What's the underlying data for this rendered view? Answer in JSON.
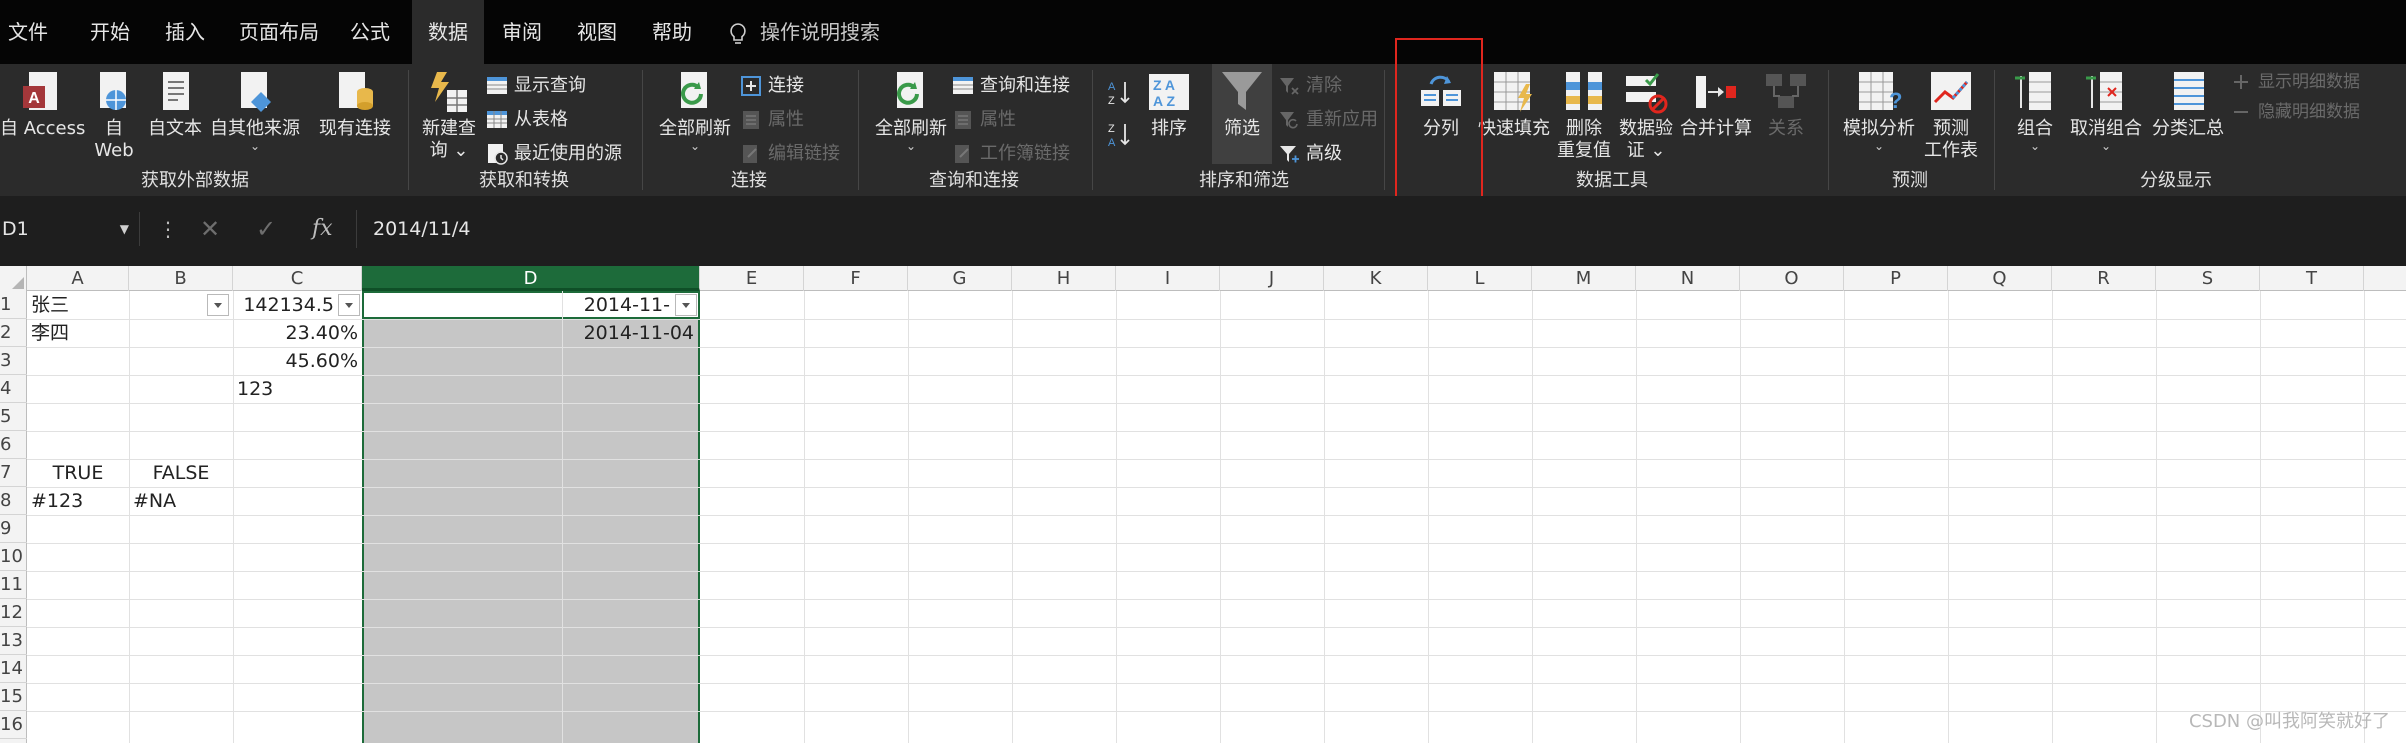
{
  "menu": {
    "tabs": [
      "文件",
      "开始",
      "插入",
      "页面布局",
      "公式",
      "数据",
      "审阅",
      "视图",
      "帮助"
    ],
    "active_tab": "数据",
    "tell_me": "操作说明搜索"
  },
  "ribbon": {
    "get_external_data": {
      "group_label": "获取外部数据",
      "access": "自 Access",
      "web_line1": "自",
      "web_line2": "Web",
      "text": "自文本",
      "other": "自其他来源",
      "existing": "现有连接"
    },
    "get_transform": {
      "group_label": "获取和转换",
      "new_query_line1": "新建查",
      "new_query_line2": "询",
      "show_queries": "显示查询",
      "from_table": "从表格",
      "recent_sources": "最近使用的源"
    },
    "connections": {
      "group_label": "连接",
      "refresh_all": "全部刷新",
      "connections": "连接",
      "properties": "属性",
      "edit_links": "编辑链接"
    },
    "queries_connections": {
      "group_label": "查询和连接",
      "refresh_all": "全部刷新",
      "queries_connections": "查询和连接",
      "properties": "属性",
      "workbook_links": "工作簿链接"
    },
    "sort_filter": {
      "group_label": "排序和筛选",
      "sort": "排序",
      "filter": "筛选",
      "clear": "清除",
      "reapply": "重新应用",
      "advanced": "高级"
    },
    "data_tools": {
      "group_label": "数据工具",
      "text_to_columns": "分列",
      "flash_fill": "快速填充",
      "remove_dup_line1": "删除",
      "remove_dup_line2": "重复值",
      "validation_line1": "数据验",
      "validation_line2": "证",
      "consolidate": "合并计算",
      "relationships": "关系"
    },
    "forecast": {
      "group_label": "预测",
      "what_if": "模拟分析",
      "forecast_line1": "预测",
      "forecast_line2": "工作表"
    },
    "outline": {
      "group_label": "分级显示",
      "group": "组合",
      "ungroup": "取消组合",
      "subtotal": "分类汇总",
      "show_detail": "显示明细数据",
      "hide_detail": "隐藏明细数据"
    }
  },
  "formula_bar": {
    "name_box": "D1",
    "formula": "2014/11/4",
    "fx": "fx"
  },
  "sheet": {
    "columns": [
      "A",
      "B",
      "C",
      "D",
      "E",
      "F",
      "G",
      "H",
      "I",
      "J",
      "K",
      "L",
      "M",
      "N",
      "O",
      "P",
      "Q",
      "R",
      "S",
      "T"
    ],
    "rows": [
      "1",
      "2",
      "3",
      "4",
      "5",
      "6",
      "7",
      "8",
      "9",
      "10",
      "11",
      "12",
      "13",
      "14",
      "15",
      "16"
    ],
    "selected_column": "D",
    "cells": {
      "A1": "张三",
      "A2": "李四",
      "C1": "142134.5",
      "C2": "23.40%",
      "C3": "45.60%",
      "C4": "123",
      "D1": "2014-11-",
      "D2": "2014-11-04",
      "A7": "TRUE",
      "B7": "FALSE",
      "A8": "#123",
      "B8": "#NA"
    }
  },
  "watermark": "CSDN @叫我阿笑就好了",
  "colors": {
    "accent_green": "#1d6b3a",
    "highlight_red": "#e0261e",
    "ribbon_bg": "#2b2b2b"
  }
}
